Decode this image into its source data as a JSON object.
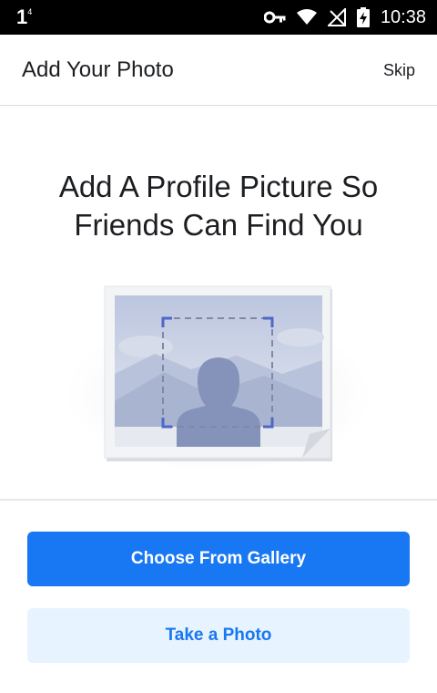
{
  "status_bar": {
    "notification_count": "1",
    "notification_sup": "4",
    "time": "10:38",
    "icons": [
      "key-icon",
      "wifi-icon",
      "no-signal-icon",
      "battery-charging-icon"
    ]
  },
  "header": {
    "title": "Add Your Photo",
    "skip_label": "Skip"
  },
  "main": {
    "headline_line1": "Add A Profile Picture So",
    "headline_line2": "Friends Can Find You",
    "illustration": "profile-photo-placeholder-icon"
  },
  "actions": {
    "gallery_label": "Choose From Gallery",
    "photo_label": "Take a Photo"
  },
  "colors": {
    "primary": "#1877f2",
    "secondary_bg": "#e7f3ff",
    "text": "#1c1e21"
  }
}
